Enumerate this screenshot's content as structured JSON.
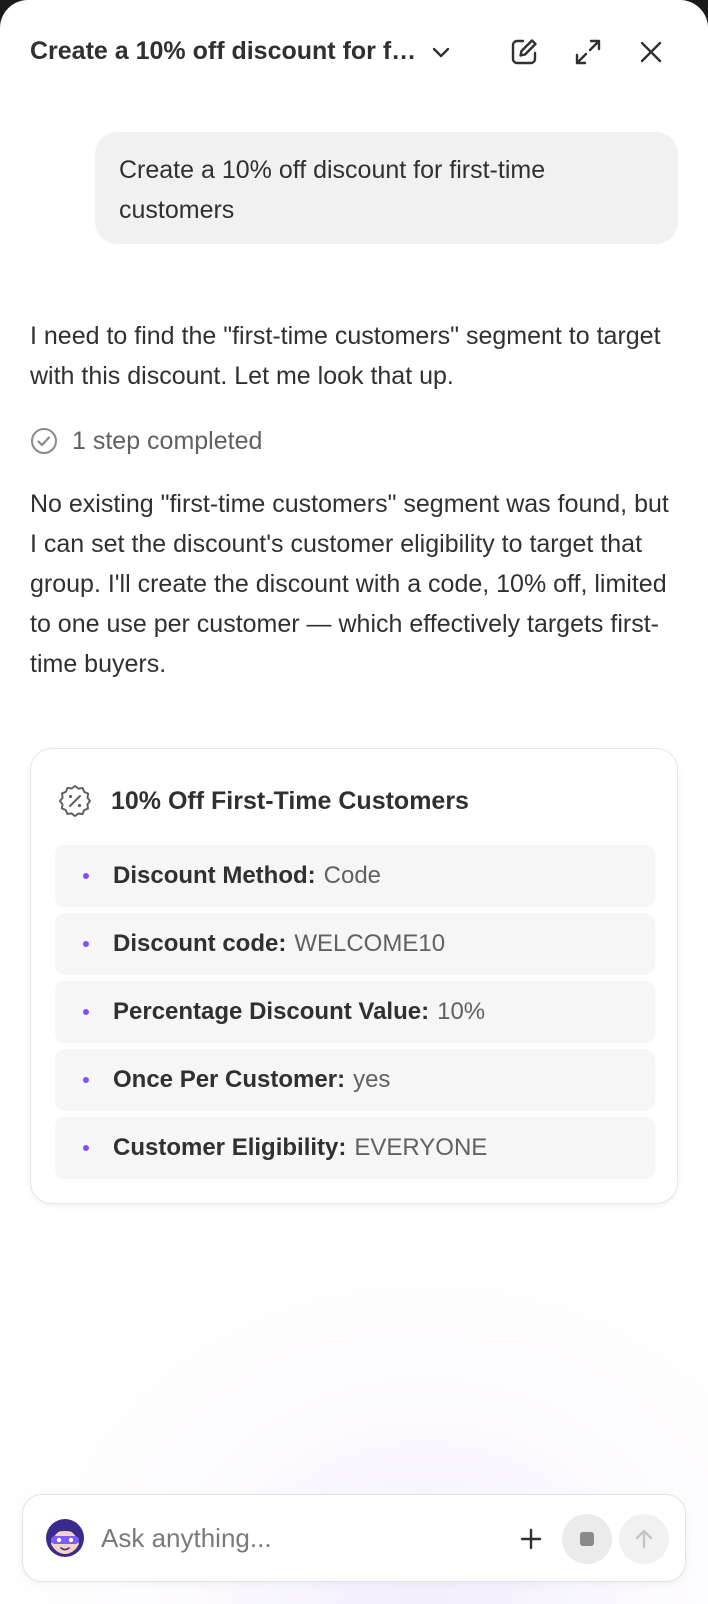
{
  "header": {
    "title": "Create a 10% off discount for first-time customers",
    "icons": [
      "chevron-down-icon",
      "edit-icon",
      "expand-icon",
      "close-icon"
    ]
  },
  "conversation": {
    "user_message": "Create a 10% off discount for first-time customers",
    "assistant_message_1": "I need to find the \"first-time customers\" segment to target with this discount. Let me look that up.",
    "steps_label": "1 step completed",
    "assistant_message_2": "No existing \"first-time customers\" segment was found, but I can set the discount's customer eligibility to target that group. I'll create the discount with a code, 10% off, limited to one use per customer — which effectively targets first-time buyers."
  },
  "discount_card": {
    "title": "10% Off First-Time Customers",
    "icon": "discount-badge-icon",
    "fields": [
      {
        "label": "Discount Method:",
        "value": "Code"
      },
      {
        "label": "Discount code:",
        "value": "WELCOME10"
      },
      {
        "label": "Percentage Discount Value:",
        "value": "10%"
      },
      {
        "label": "Once Per Customer:",
        "value": "yes"
      },
      {
        "label": "Customer Eligibility:",
        "value": "EVERYONE"
      }
    ]
  },
  "composer": {
    "placeholder": "Ask anything...",
    "value": ""
  },
  "colors": {
    "accent": "#8051ff",
    "text": "#303030",
    "muted": "#616161",
    "bubble": "#f1f1f1",
    "row_bg": "#f6f6f6"
  }
}
